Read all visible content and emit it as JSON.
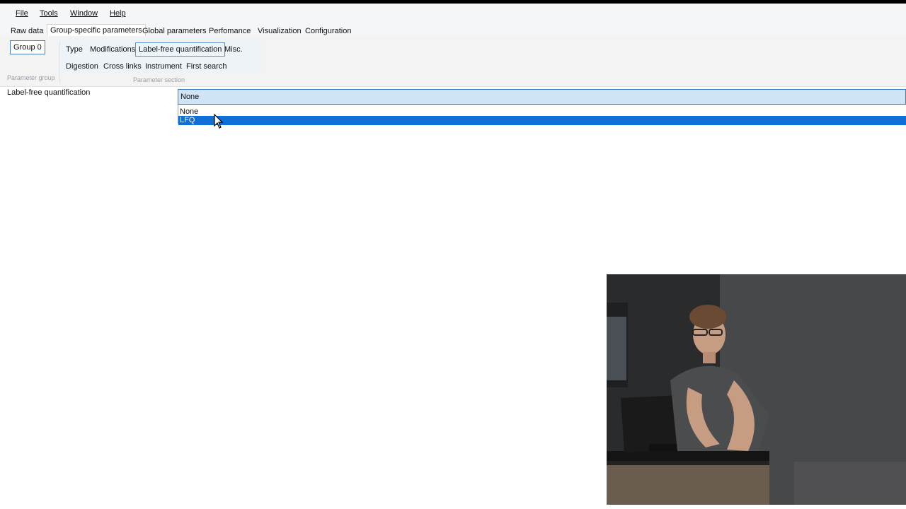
{
  "menu": [
    "File",
    "Tools",
    "Window",
    "Help"
  ],
  "tabs": [
    "Raw data",
    "Group-specific parameters",
    "Global parameters",
    "Perfomance",
    "Visualization",
    "Configuration"
  ],
  "active_tab": "Group-specific parameters",
  "ribbon": {
    "group_button": "Group 0",
    "group_label": "Parameter group",
    "section_row1": [
      "Type",
      "Modifications",
      "Label-free quantification",
      "Misc."
    ],
    "section_row2": [
      "Digestion",
      "Cross links",
      "Instrument",
      "First search"
    ],
    "section_label": "Parameter section"
  },
  "field": {
    "label": "Label-free quantification",
    "value": "None",
    "options": [
      "None",
      "LFQ"
    ],
    "highlighted": "LFQ"
  },
  "colors": {
    "accent": "#0f6fd6",
    "combo_bg": "#cfe5f7",
    "combo_border": "#3c7fc4"
  }
}
